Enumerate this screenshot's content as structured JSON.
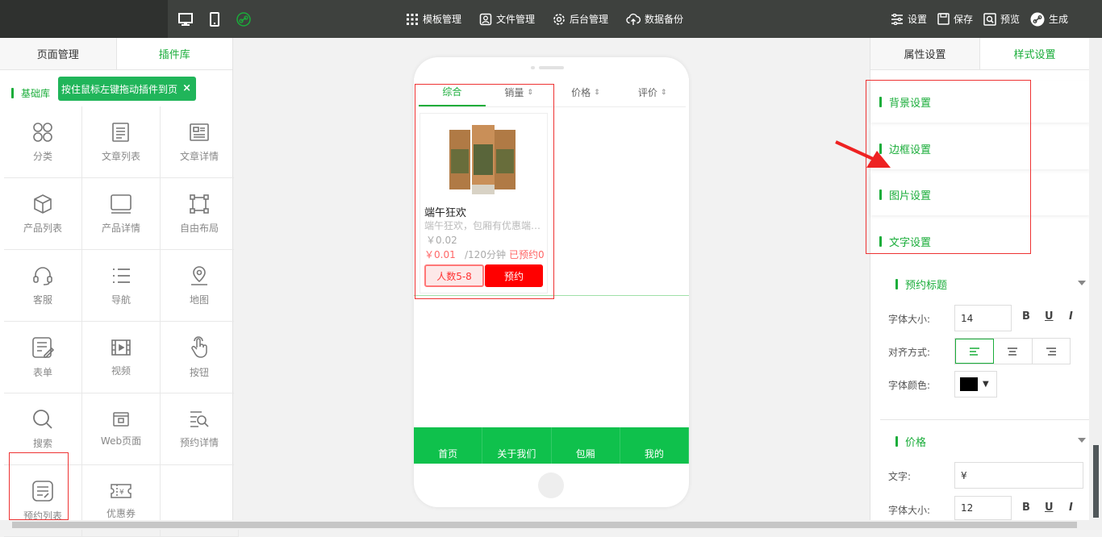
{
  "topbar": {
    "menu": [
      {
        "label": "模板管理",
        "icon": "grid-icon"
      },
      {
        "label": "文件管理",
        "icon": "file-user-icon"
      },
      {
        "label": "后台管理",
        "icon": "gear-icon"
      },
      {
        "label": "数据备份",
        "icon": "cloud-upload-icon"
      }
    ],
    "actions": [
      {
        "label": "设置",
        "icon": "sliders-icon"
      },
      {
        "label": "保存",
        "icon": "save-icon"
      },
      {
        "label": "预览",
        "icon": "preview-icon"
      },
      {
        "label": "生成",
        "icon": "generate-icon"
      }
    ]
  },
  "left_panel": {
    "tabs": [
      "页面管理",
      "插件库"
    ],
    "active_tab": "插件库",
    "section_title": "基础库",
    "tooltip": "按住鼠标左键拖动插件到页",
    "tooltip_close": "×",
    "plugins": [
      {
        "label": "分类",
        "icon": "category-icon"
      },
      {
        "label": "文章列表",
        "icon": "article-list-icon"
      },
      {
        "label": "文章详情",
        "icon": "article-detail-icon"
      },
      {
        "label": "产品列表",
        "icon": "product-box-icon"
      },
      {
        "label": "产品详情",
        "icon": "product-detail-icon"
      },
      {
        "label": "自由布局",
        "icon": "free-layout-icon"
      },
      {
        "label": "客服",
        "icon": "headset-icon"
      },
      {
        "label": "导航",
        "icon": "nav-list-icon"
      },
      {
        "label": "地图",
        "icon": "map-pin-icon"
      },
      {
        "label": "表单",
        "icon": "form-icon"
      },
      {
        "label": "视频",
        "icon": "video-icon"
      },
      {
        "label": "按钮",
        "icon": "pointer-icon"
      },
      {
        "label": "搜索",
        "icon": "search-icon"
      },
      {
        "label": "Web页面",
        "icon": "web-page-icon"
      },
      {
        "label": "预约详情",
        "icon": "booking-detail-icon"
      },
      {
        "label": "预约列表",
        "icon": "booking-list-icon"
      },
      {
        "label": "优惠券",
        "icon": "coupon-icon"
      }
    ]
  },
  "phone": {
    "sort_tabs": [
      "综合",
      "销量",
      "价格",
      "评价"
    ],
    "active_sort": "综合",
    "product": {
      "title": "端午狂欢",
      "desc": "端午狂欢，包厢有优惠端午狂欢",
      "orig_price": "￥0.02",
      "price": "￥0.01",
      "duration": "/120分钟",
      "booked": "已预约0",
      "people_button": "人数5-8",
      "book_button": "预约"
    },
    "footer_nav": [
      "首页",
      "关于我们",
      "包厢",
      "我的"
    ]
  },
  "right_panel": {
    "tabs": [
      "属性设置",
      "样式设置"
    ],
    "active_tab": "样式设置",
    "sections": [
      "背景设置",
      "边框设置",
      "图片设置",
      "文字设置"
    ],
    "subsection1": {
      "title": "预约标题",
      "font_size_label": "字体大小:",
      "font_size": "14",
      "align_label": "对齐方式:",
      "color_label": "字体颜色:",
      "bold": "B",
      "underline": "U",
      "italic": "I"
    },
    "subsection2": {
      "title": "价格",
      "text_label": "文字:",
      "text_value": "¥",
      "font_size_label": "字体大小:",
      "font_size": "12",
      "bold": "B",
      "underline": "U",
      "italic": "I"
    }
  },
  "colors": {
    "accent": "#1aad3a",
    "topbar": "#3e413e",
    "footer_green": "#0fc14c",
    "price_red": "#ff6666",
    "book_red": "#ff0000"
  }
}
